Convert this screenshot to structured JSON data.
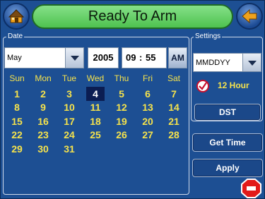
{
  "header": {
    "title": "Ready To Arm",
    "home_icon": "home-icon",
    "back_icon": "back-arrow-icon"
  },
  "date_panel": {
    "label": "Date",
    "month": "May",
    "year": "2005",
    "time_hour": "09",
    "time_sep": ":",
    "time_minute": "55",
    "ampm": "AM"
  },
  "calendar": {
    "weekdays": [
      "Sun",
      "Mon",
      "Tue",
      "Wed",
      "Thu",
      "Fri",
      "Sat"
    ],
    "weeks": [
      [
        "1",
        "2",
        "3",
        "4",
        "5",
        "6",
        "7"
      ],
      [
        "8",
        "9",
        "10",
        "11",
        "12",
        "13",
        "14"
      ],
      [
        "15",
        "16",
        "17",
        "18",
        "19",
        "20",
        "21"
      ],
      [
        "22",
        "23",
        "24",
        "25",
        "26",
        "27",
        "28"
      ],
      [
        "29",
        "30",
        "31",
        "",
        "",
        "",
        ""
      ]
    ],
    "selected_day": "4"
  },
  "settings": {
    "label": "Settings",
    "date_format": "MMDDYY",
    "hour12_label": "12 Hour",
    "hour12_checked": true,
    "dst_label": "DST"
  },
  "actions": {
    "get_time": "Get Time",
    "apply": "Apply",
    "stop_icon": "stop-sign-icon"
  },
  "colors": {
    "background": "#1d4f93",
    "title_green": "#4ec24f",
    "day_text": "#f5e24c",
    "selected_day_bg": "#0b1d52",
    "back_arrow": "#f0a21c",
    "stop_red": "#e21a1a"
  }
}
